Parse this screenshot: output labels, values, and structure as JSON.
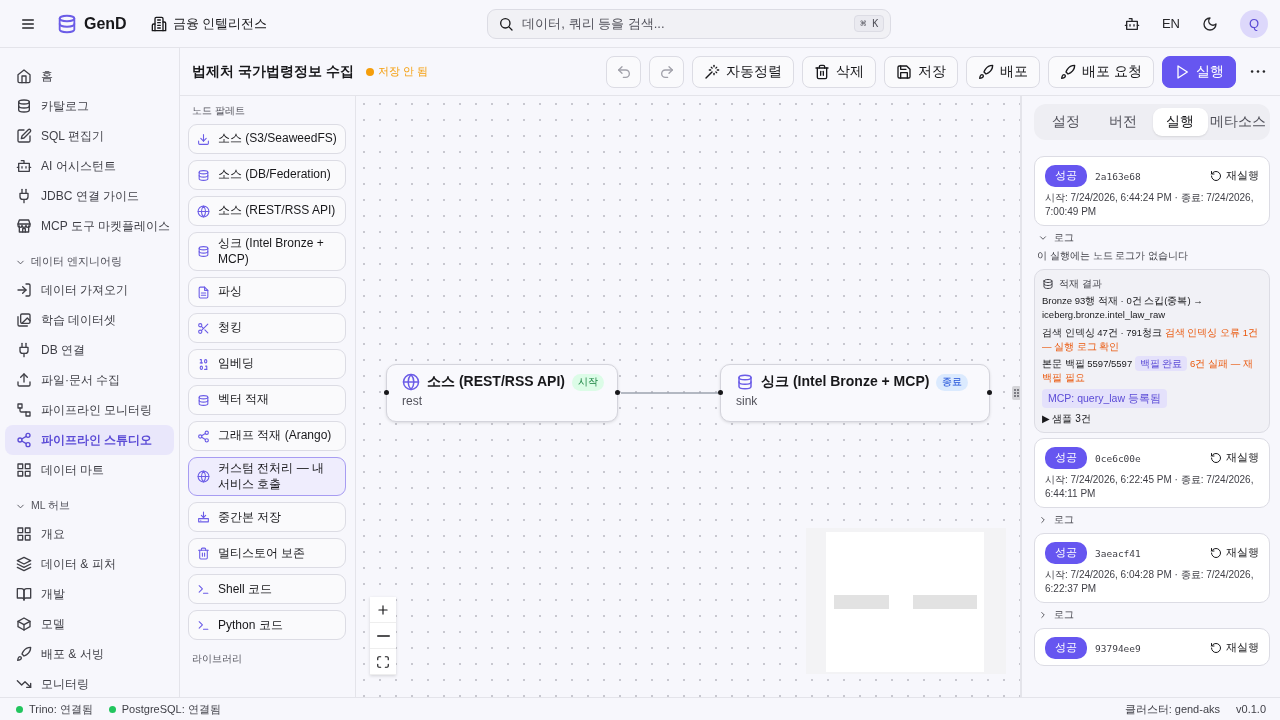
{
  "topbar": {
    "brand": "GenD",
    "workspace": "금융 인텔리전스",
    "search": {
      "placeholder": "데이터, 쿼리 등을 검색...",
      "shortcut": "⌘ K"
    },
    "language": "EN",
    "avatar": "Q"
  },
  "sidebar": {
    "sections": [
      {
        "items": [
          {
            "label": "홈",
            "selected": false
          },
          {
            "label": "카탈로그",
            "selected": false
          },
          {
            "label": "SQL 편집기",
            "selected": false
          },
          {
            "label": "AI 어시스턴트",
            "selected": false
          },
          {
            "label": "JDBC 연결 가이드",
            "selected": false
          },
          {
            "label": "MCP 도구 마켓플레이스",
            "selected": false
          }
        ]
      },
      {
        "title": "데이터 엔지니어링",
        "expanded": true,
        "items": [
          {
            "label": "데이터 가져오기",
            "selected": false
          },
          {
            "label": "학습 데이터셋",
            "selected": false
          },
          {
            "label": "DB 연결",
            "selected": false
          },
          {
            "label": "파일·문서 수집",
            "selected": false
          },
          {
            "label": "파이프라인 모니터링",
            "selected": false
          },
          {
            "label": "파이프라인 스튜디오",
            "selected": true
          },
          {
            "label": "데이터 마트",
            "selected": false
          }
        ]
      },
      {
        "title": "ML 허브",
        "expanded": true,
        "items": [
          {
            "label": "개요",
            "selected": false
          },
          {
            "label": "데이터 & 피처",
            "selected": false
          },
          {
            "label": "개발",
            "selected": false
          },
          {
            "label": "모델",
            "selected": false
          },
          {
            "label": "배포 & 서빙",
            "selected": false
          },
          {
            "label": "모니터링",
            "selected": false
          }
        ]
      }
    ]
  },
  "header": {
    "title": "법제처 국가법령정보 수집",
    "status": "저장 안 됨",
    "undo": {
      "disabled": true
    },
    "redo": {
      "disabled": true
    },
    "buttons": [
      {
        "label": "자동정렬",
        "kind": "default"
      },
      {
        "label": "삭제",
        "kind": "default"
      },
      {
        "label": "저장",
        "kind": "default"
      },
      {
        "label": "배포",
        "kind": "default"
      },
      {
        "label": "배포 요청",
        "kind": "default"
      },
      {
        "label": "실행",
        "kind": "primary"
      }
    ]
  },
  "palette": {
    "title": "노드 팔레트",
    "items": [
      {
        "label": "소스 (S3/SeaweedFS)",
        "selected": false
      },
      {
        "label": "소스 (DB/Federation)",
        "selected": false
      },
      {
        "label": "소스 (REST/RSS API)",
        "selected": false
      },
      {
        "label": "싱크 (Intel Bronze + MCP)",
        "selected": false
      },
      {
        "label": "파싱",
        "selected": false
      },
      {
        "label": "청킹",
        "selected": false
      },
      {
        "label": "임베딩",
        "selected": false
      },
      {
        "label": "벡터 적재",
        "selected": false
      },
      {
        "label": "그래프 적재 (Arango)",
        "selected": false
      },
      {
        "label": "커스텀 전처리 — 내 서비스 호출",
        "selected": true
      },
      {
        "label": "중간본 저장",
        "selected": false
      },
      {
        "label": "멀티스토어 보존",
        "selected": false
      },
      {
        "label": "Shell 코드",
        "selected": false
      },
      {
        "label": "Python 코드",
        "selected": false
      }
    ],
    "library_title": "라이브러리"
  },
  "canvas": {
    "nodes": [
      {
        "title": "소스 (REST/RSS API)",
        "badge": "시작",
        "kind": "source",
        "subtitle": "rest"
      },
      {
        "title": "싱크 (Intel Bronze + MCP)",
        "badge": "종료",
        "kind": "sink",
        "subtitle": "sink"
      }
    ]
  },
  "panel": {
    "tabs": [
      {
        "label": "설정",
        "selected": false
      },
      {
        "label": "버전",
        "selected": false
      },
      {
        "label": "실행",
        "selected": true
      },
      {
        "label": "메타소스",
        "selected": false
      }
    ],
    "runs": [
      {
        "status": "성공",
        "id": "2a163e68",
        "rerun": "재실행",
        "time": "시작: 7/24/2026, 6:44:24 PM · 종료: 7/24/2026, 7:00:49 PM",
        "log": {
          "label": "로그",
          "expanded": true,
          "empty_text": "이 실행에는 노드 로그가 없습니다"
        },
        "result": {
          "title": "적재 결과",
          "lines": [
            {
              "text": "Bronze 93행 적재 · 0건 스킵(중복) → iceberg.bronze.intel_law_raw"
            },
            {
              "text": "검색 인덱싱 47건 · 791청크",
              "warning": "검색 인덱싱 오류 1건 — 실행 로그 확인"
            },
            {
              "text": "본문 백필 5597/5597",
              "tag": "백필 완료",
              "warning": "6건 실패 — 재백필 필요"
            }
          ],
          "mcp_tag": "MCP: query_law 등록됨",
          "samples": "▶ 샘플 3건"
        }
      },
      {
        "status": "성공",
        "id": "0ce6c00e",
        "rerun": "재실행",
        "time": "시작: 7/24/2026, 6:22:45 PM · 종료: 7/24/2026, 6:44:11 PM",
        "log": {
          "label": "로그",
          "expanded": false
        }
      },
      {
        "status": "성공",
        "id": "3aeacf41",
        "rerun": "재실행",
        "time": "시작: 7/24/2026, 6:04:28 PM · 종료: 7/24/2026, 6:22:37 PM",
        "log": {
          "label": "로그",
          "expanded": false
        }
      },
      {
        "status": "성공",
        "id": "93794ee9",
        "rerun": "재실행"
      }
    ]
  },
  "status_bar": {
    "connections": [
      {
        "label": "Trino: 연결됨",
        "connected": true
      },
      {
        "label": "PostgreSQL: 연결됨",
        "connected": true
      }
    ],
    "cluster": "클러스터: gend-aks",
    "version": "v0.1.0"
  }
}
